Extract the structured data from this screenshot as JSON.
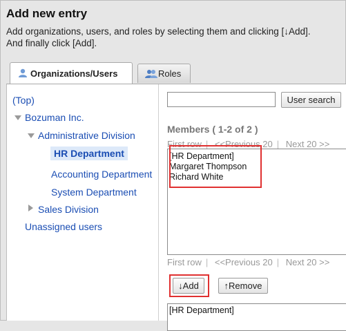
{
  "header": {
    "title": "Add new entry",
    "desc_line1": "Add organizations, users, and roles by selecting them and clicking [↓Add].",
    "desc_line2": "And finally click [Add]."
  },
  "tabs": [
    {
      "label": "Organizations/Users",
      "active": true
    },
    {
      "label": "Roles",
      "active": false
    }
  ],
  "tree": {
    "top": "(Top)",
    "org": "Bozuman Inc.",
    "admin": "Administrative Division",
    "hr": "HR Department",
    "accounting": "Accounting Department",
    "system": "System Department",
    "sales": "Sales Division",
    "unassigned": "Unassigned users"
  },
  "search": {
    "value": "",
    "button": "User search"
  },
  "members": {
    "heading": "Members ( 1-2 of 2 )",
    "first": "First row",
    "prev": "<<Previous 20",
    "next": "Next 20 >>",
    "items": [
      "[HR Department]",
      "Margaret Thompson",
      "Richard White"
    ]
  },
  "actions": {
    "add": "↓Add",
    "remove": "↑Remove"
  },
  "selected": {
    "items": [
      "[HR Department]"
    ]
  },
  "colors": {
    "link": "#1a4db3",
    "highlight": "#e03030",
    "selection_bg": "#dde9f9"
  }
}
